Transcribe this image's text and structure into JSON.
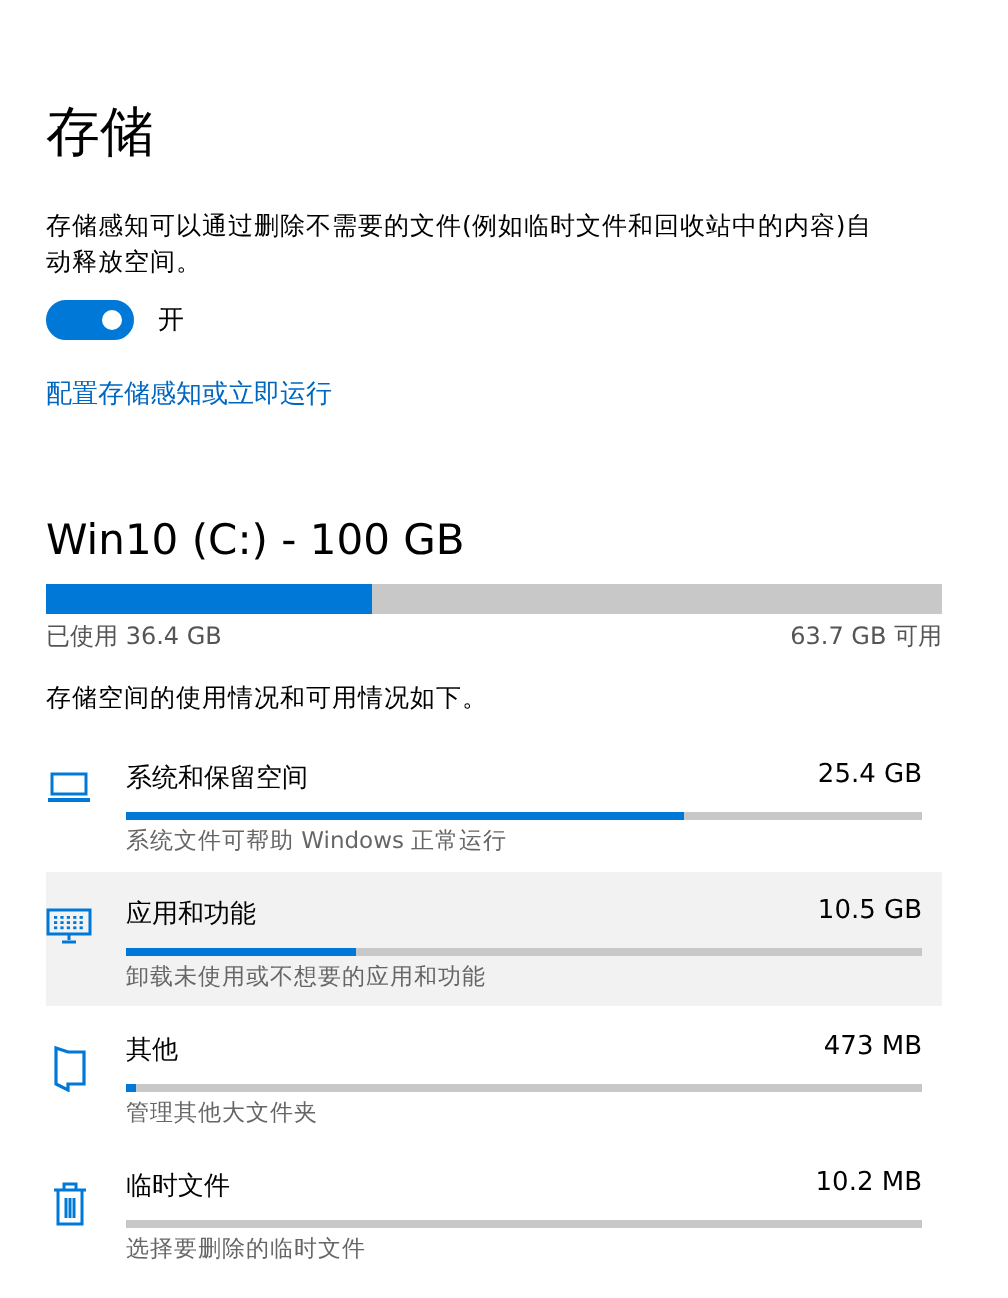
{
  "title": "存储",
  "storage_sense": {
    "description": "存储感知可以通过删除不需要的文件(例如临时文件和回收站中的内容)自动释放空间。",
    "toggle": {
      "on": true,
      "label": "开"
    },
    "link": "配置存储感知或立即运行"
  },
  "drive": {
    "name": "Win10 (C:) - 100 GB",
    "level": 0.364,
    "used": "已使用 36.4 GB",
    "free": "63.7 GB 可用"
  },
  "caption": "存储空间的使用情况和可用情况如下。",
  "categories": [
    {
      "kind": "laptop",
      "name": "系统和保留空间",
      "size": "25.4 GB",
      "level": 0.7,
      "description": "系统文件可帮助 Windows 正常运行",
      "hovered": false
    },
    {
      "kind": "keyboard",
      "name": "应用和功能",
      "size": "10.5 GB",
      "level": 0.29,
      "description": "卸载未使用或不想要的应用和功能",
      "hovered": true
    },
    {
      "kind": "folder",
      "name": "其他",
      "size": "473 MB",
      "level": 0.012,
      "description": "管理其他大文件夹",
      "hovered": false
    },
    {
      "kind": "trash",
      "name": "临时文件",
      "size": "10.2 MB",
      "description": "选择要删除的临时文件",
      "hovered": false
    }
  ]
}
